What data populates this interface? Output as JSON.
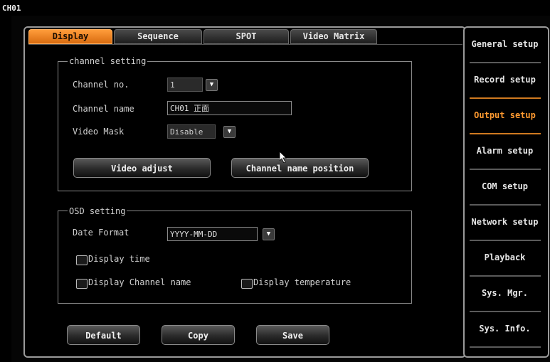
{
  "window": {
    "title": "CH01"
  },
  "tabs": [
    {
      "label": "Display",
      "active": true
    },
    {
      "label": "Sequence",
      "active": false
    },
    {
      "label": "SPOT",
      "active": false
    },
    {
      "label": "Video Matrix",
      "active": false
    }
  ],
  "channel_setting": {
    "legend": "channel setting",
    "channel_no_label": "Channel no.",
    "channel_no_value": "1",
    "channel_name_label": "Channel name",
    "channel_name_value": "CH01   正面",
    "video_mask_label": "Video Mask",
    "video_mask_value": "Disable",
    "video_adjust_label": "Video adjust",
    "name_position_label": "Channel name position"
  },
  "osd_setting": {
    "legend": "OSD setting",
    "date_format_label": "Date Format",
    "date_format_value": "YYYY-MM-DD",
    "display_time_label": "Display time",
    "display_channel_name_label": "Display Channel name",
    "display_temperature_label": "Display temperature"
  },
  "footer": {
    "default_label": "Default",
    "copy_label": "Copy",
    "save_label": "Save"
  },
  "side_menu": [
    {
      "label": "General setup",
      "active": false
    },
    {
      "label": "Record setup",
      "active": false
    },
    {
      "label": "Output setup",
      "active": true
    },
    {
      "label": "Alarm setup",
      "active": false
    },
    {
      "label": "COM setup",
      "active": false
    },
    {
      "label": "Network setup",
      "active": false
    },
    {
      "label": "Playback",
      "active": false
    },
    {
      "label": "Sys. Mgr.",
      "active": false
    },
    {
      "label": "Sys. Info.",
      "active": false
    }
  ],
  "colors": {
    "accent": "#ff9a30",
    "active_tab": "#f0861f",
    "background": "#000000",
    "border": "#9a9a9a"
  }
}
